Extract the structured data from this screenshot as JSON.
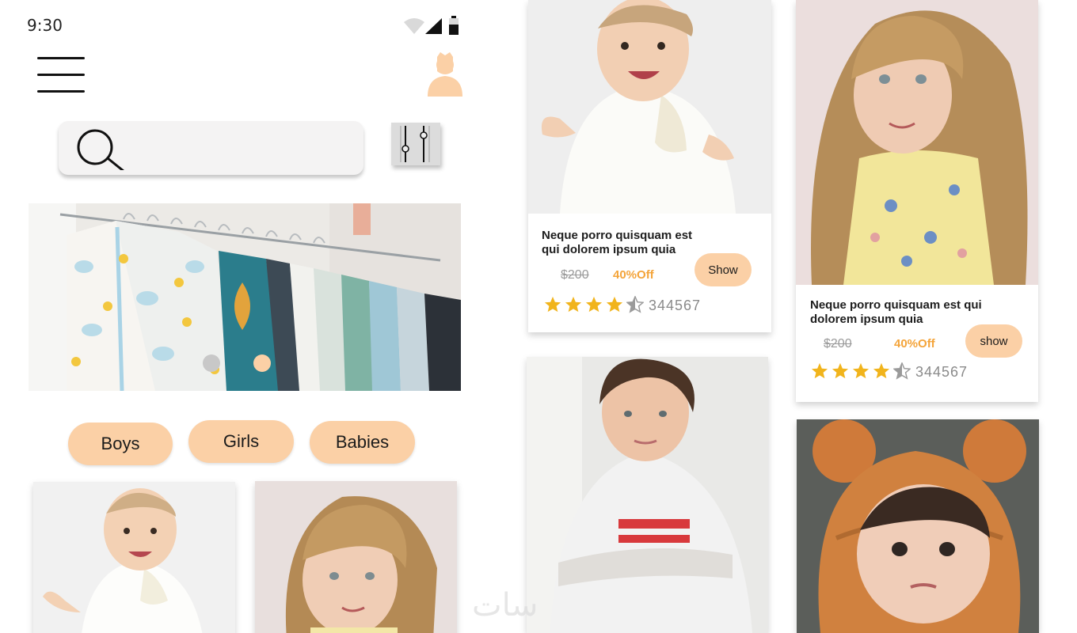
{
  "status_bar": {
    "time": "9:30"
  },
  "search": {
    "placeholder": ""
  },
  "categories": [
    {
      "label": "Boys"
    },
    {
      "label": "Girls"
    },
    {
      "label": "Babies"
    }
  ],
  "products": [
    {
      "title": "Neque porro quisquam est qui dolorem ipsum quia",
      "old_price": "$200",
      "discount": "40%Off",
      "button": "Show",
      "rating": 4.5,
      "rating_count": "344567"
    },
    {
      "title": "Neque porro quisquam est qui dolorem ipsum quia",
      "old_price": "$200",
      "discount": "40%Off",
      "button": "show",
      "rating": 4.5,
      "rating_count": "344567"
    }
  ],
  "colors": {
    "accent": "#fbd0a6",
    "star": "#f1b41c",
    "discount": "#f4a43a"
  },
  "watermark": "سات"
}
